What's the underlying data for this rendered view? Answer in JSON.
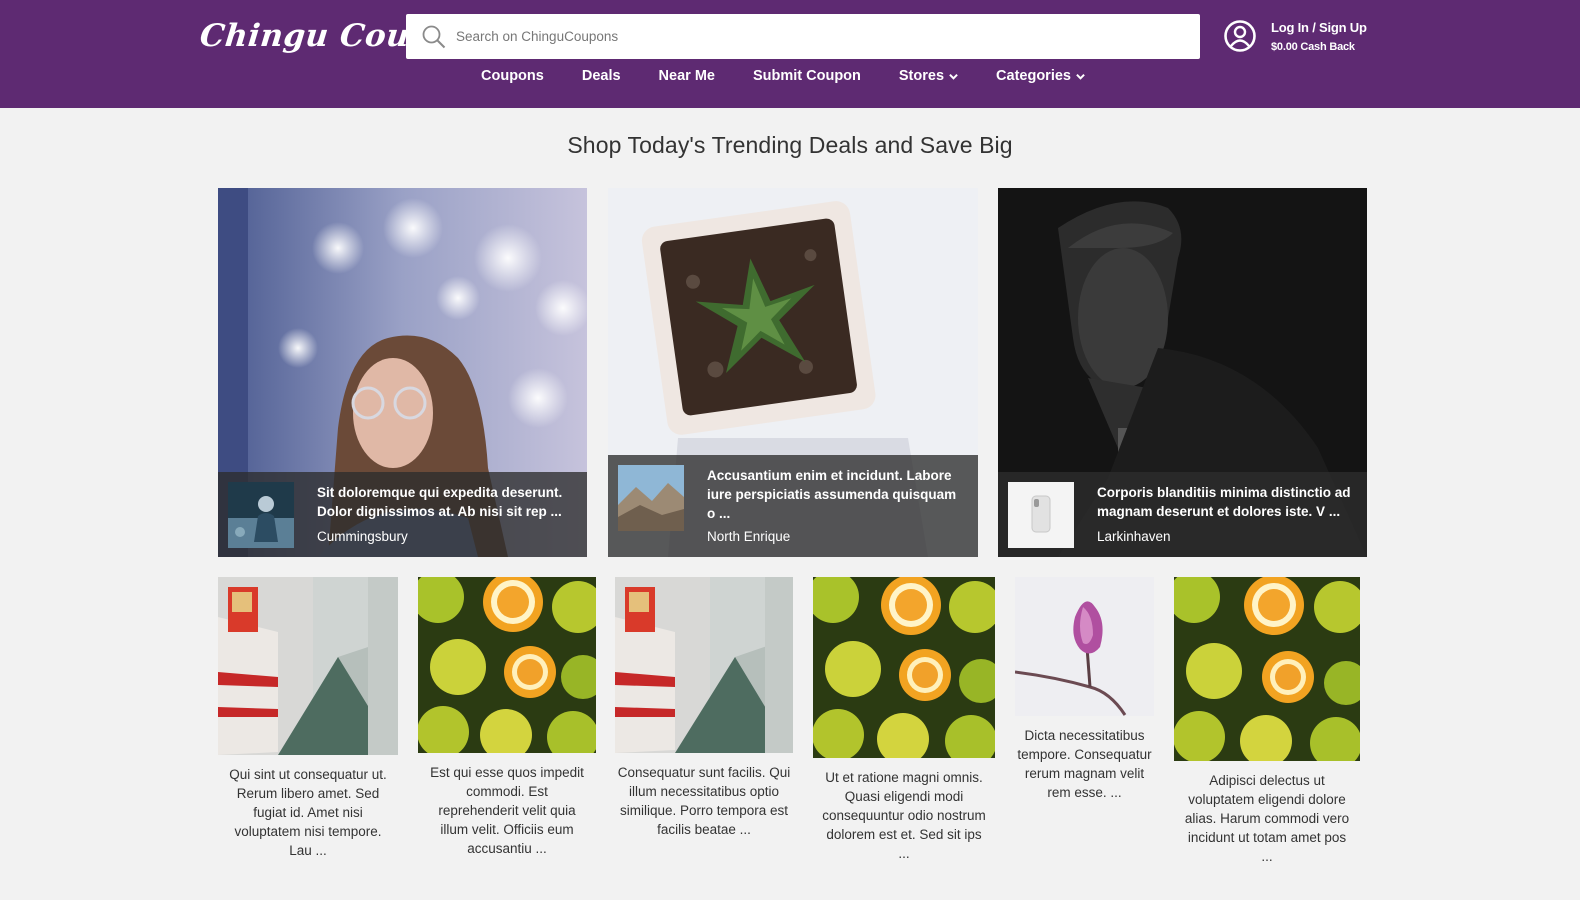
{
  "header": {
    "logo": "Chingu Coupons",
    "search_placeholder": "Search on ChinguCoupons",
    "login_label": "Log In / Sign Up",
    "cashback": "$0.00 Cash Back"
  },
  "nav": [
    {
      "label": "Coupons"
    },
    {
      "label": "Deals"
    },
    {
      "label": "Near Me"
    },
    {
      "label": "Submit Coupon"
    },
    {
      "label": "Stores",
      "dropdown": true
    },
    {
      "label": "Categories",
      "dropdown": true
    }
  ],
  "page_title": "Shop Today's Trending Deals and Save Big",
  "featured": [
    {
      "title": "Sit doloremque qui expedita deserunt. Dolor dignissimos at. Ab nisi sit rep ...",
      "location": "Cummingsbury",
      "photo_icon": "woman-portrait",
      "thumb_icon": "person-snow"
    },
    {
      "title": "Accusantium enim et incidunt. Labore iure perspiciatis assumenda quisquam o ...",
      "location": "North Enrique",
      "photo_icon": "succulent-plant",
      "thumb_icon": "mountain-landscape"
    },
    {
      "title": "Corporis blanditiis minima distinctio ad magnam deserunt et dolores iste. V ...",
      "location": "Larkinhaven",
      "photo_icon": "man-portrait-dark",
      "thumb_icon": "smartphone"
    }
  ],
  "cards": [
    {
      "description": "Qui sint ut consequatur ut. Rerum libero amet. Sed fugiat id. Amet nisi voluptatem nisi tempore. Lau ...",
      "image_icon": "subway-train"
    },
    {
      "description": "Est qui esse quos impedit commodi. Est reprehenderit velit quia illum velit. Officiis eum accusantiu ...",
      "image_icon": "oranges"
    },
    {
      "description": "Consequatur sunt facilis. Qui illum necessitatibus optio similique. Porro tempora est facilis beatae ...",
      "image_icon": "subway-train"
    },
    {
      "description": "Ut et ratione magni omnis. Quasi eligendi modi consequuntur odio nostrum dolorem est et. Sed sit ips ...",
      "image_icon": "oranges"
    },
    {
      "description": "Dicta necessitatibus tempore. Consequatur rerum magnam velit rem esse. ...",
      "image_icon": "magnolia-flower"
    },
    {
      "description": "Adipisci delectus ut voluptatem eligendi dolore alias. Harum commodi vero incidunt ut totam amet pos ...",
      "image_icon": "oranges"
    }
  ],
  "colors": {
    "brand": "#5e2a72",
    "background": "#f2f2f2",
    "overlay": "#2d2d2d"
  }
}
